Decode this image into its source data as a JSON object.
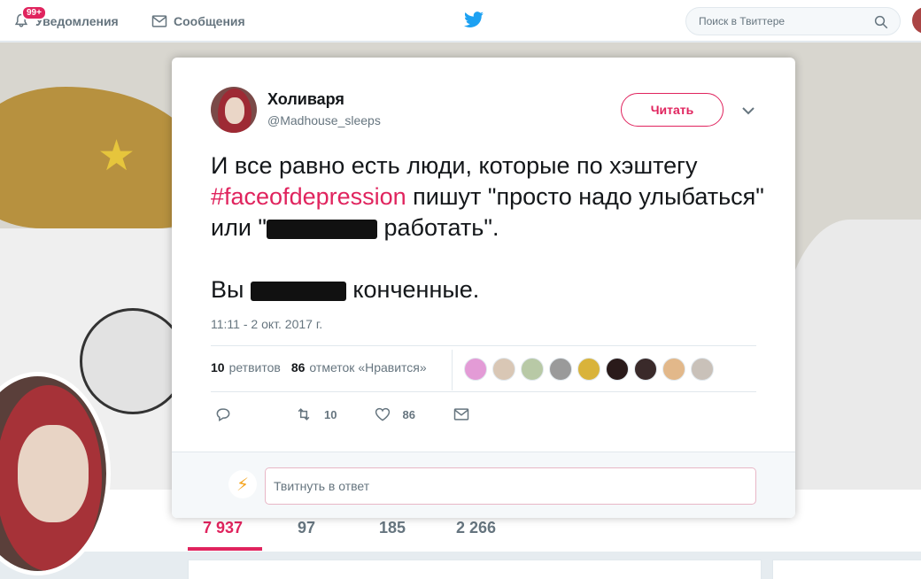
{
  "topbar": {
    "notifications_label": "Уведомления",
    "notifications_badge": "99+",
    "messages_label": "Сообщения",
    "search_placeholder": "Поиск в Твиттере"
  },
  "profile": {
    "stats": [
      "7 937",
      "97",
      "185",
      "2 266"
    ]
  },
  "tweet": {
    "user_name": "Холиваря",
    "user_handle": "@Madhouse_sleeps",
    "follow_label": "Читать",
    "text_part1": "И все равно есть люди, которые по хэштегу ",
    "hashtag": "#faceofdepression",
    "text_part2": " пишут \"просто надо улыбаться\" или \"",
    "text_part3": " работать\".",
    "text_para2_start": "Вы ",
    "text_para2_end": " конченные.",
    "timestamp": "11:11 - 2 окт. 2017 г.",
    "retweets_count": "10",
    "retweets_label": "ретвитов",
    "likes_count": "86",
    "likes_label": "отметок «Нравится»",
    "action_retweet_count": "10",
    "action_like_count": "86",
    "reply_placeholder": "Твитнуть в ответ"
  },
  "likers_colors": [
    "#e39bd6",
    "#d9c7b5",
    "#b8c9a6",
    "#9a9a9a",
    "#d9b33a",
    "#2a1a1a",
    "#3a2a2a",
    "#e2b88a",
    "#c9c1b9"
  ],
  "colors": {
    "accent": "#e0245e",
    "twitter_blue": "#1da1f2"
  }
}
